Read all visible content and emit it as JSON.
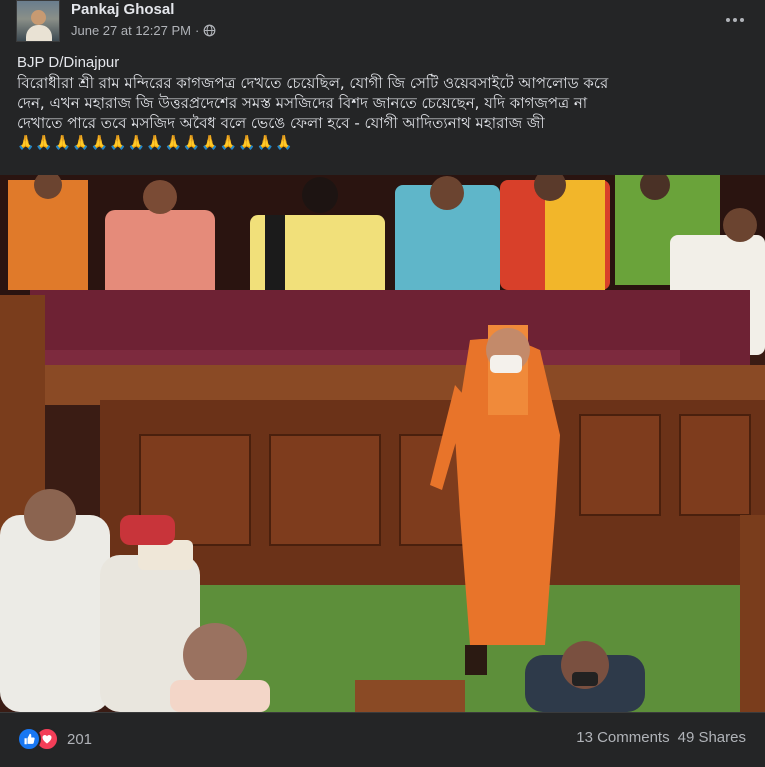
{
  "post": {
    "author": "Pankaj Ghosal",
    "timestamp": "June 27 at 12:27 PM",
    "privacy_icon": "globe-icon",
    "text": {
      "line1": "BJP D/Dinajpur",
      "line2": "বিরোধীরা শ্রী রাম মন্দিরের কাগজপত্র দেখতে চেয়েছিল, যোগী জি সেটি ওয়েবসাইটে আপলোড করে",
      "line3": "দেন, এখন মহারাজ জি উত্তরপ্রদেশের সমস্ত মসজিদের বিশদ জানতে চেয়েছেন, যদি কাগজপত্র না",
      "line4": "দেখাতে পারে তবে মসজিদ অবৈধ বলে ভেঙে ফেলা হবে - যোগী আদিত্যনাথ মহারাজ জী",
      "emoji": "🙏🙏🙏🙏🙏🙏🙏🙏🙏🙏🙏🙏🙏🙏🙏"
    }
  },
  "footer": {
    "reactions_count": "201",
    "comments": "13 Comments",
    "shares": "49 Shares"
  },
  "colors": {
    "background": "#242526",
    "text_primary": "#e4e6eb",
    "text_secondary": "#b0b3b8",
    "like_blue": "#1877f2",
    "love_red": "#f33e58",
    "saffron": "#e8742a"
  }
}
